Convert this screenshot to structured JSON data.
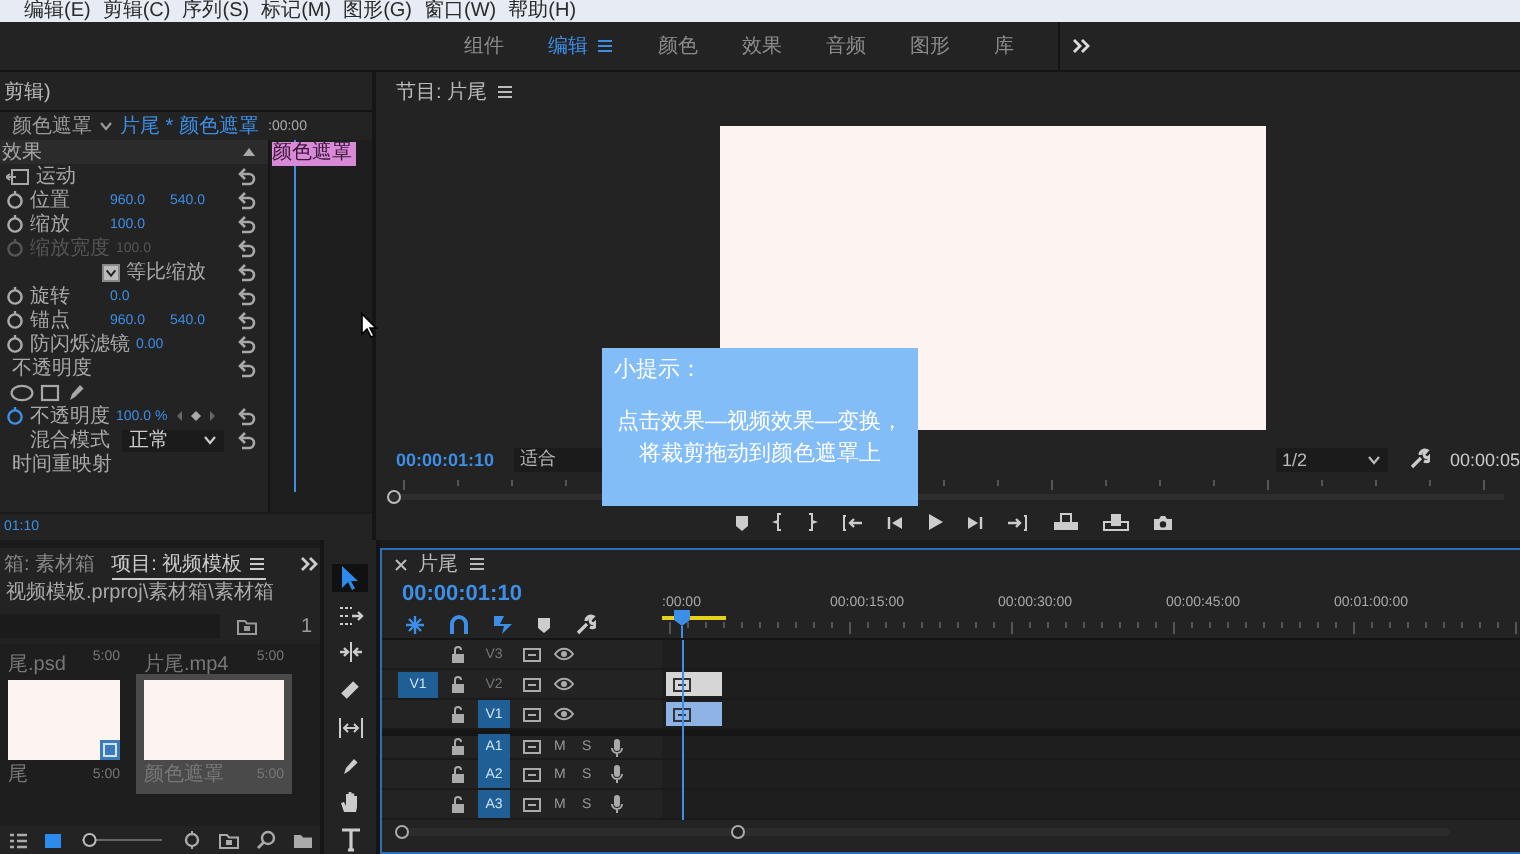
{
  "menu": [
    "编辑(E)",
    "剪辑(C)",
    "序列(S)",
    "标记(M)",
    "图形(G)",
    "窗口(W)",
    "帮助(H)"
  ],
  "workspace": {
    "tabs": [
      {
        "label": "组件",
        "selected": false
      },
      {
        "label": "编辑",
        "selected": true
      },
      {
        "label": "颜色",
        "selected": false
      },
      {
        "label": "效果",
        "selected": false
      },
      {
        "label": "音频",
        "selected": false
      },
      {
        "label": "图形",
        "selected": false
      },
      {
        "label": "库",
        "selected": false
      }
    ]
  },
  "effects": {
    "header": "剪辑)",
    "source": "颜色遮罩",
    "sequence_clip": "片尾 * 颜色遮罩",
    "time": ":00:00",
    "clip_label": "颜色遮罩",
    "timecode": "01:10",
    "rows": [
      {
        "kind": "section",
        "label": "效果"
      },
      {
        "kind": "motion",
        "label": "运动"
      },
      {
        "kind": "prop",
        "label": "位置",
        "values": [
          "960.0",
          "540.0"
        ],
        "disabled": false,
        "animated": false
      },
      {
        "kind": "prop",
        "label": "缩放",
        "values": [
          "100.0"
        ],
        "disabled": false,
        "animated": false
      },
      {
        "kind": "prop",
        "label": "缩放宽度",
        "values": [
          "100.0"
        ],
        "disabled": true,
        "animated": false
      },
      {
        "kind": "checkbox",
        "label": "等比缩放",
        "checked": true
      },
      {
        "kind": "prop",
        "label": "旋转",
        "values": [
          "0.0"
        ],
        "disabled": false,
        "animated": false
      },
      {
        "kind": "prop",
        "label": "锚点",
        "values": [
          "960.0",
          "540.0"
        ],
        "disabled": false,
        "animated": false
      },
      {
        "kind": "prop",
        "label": "防闪烁滤镜",
        "values": [
          "0.00"
        ],
        "disabled": false,
        "animated": false
      },
      {
        "kind": "group",
        "label": "不透明度"
      },
      {
        "kind": "masks"
      },
      {
        "kind": "prop",
        "label": "不透明度",
        "values": [
          "100.0 %"
        ],
        "disabled": false,
        "animated": true
      },
      {
        "kind": "dropdown",
        "label": "混合模式",
        "value": "正常"
      },
      {
        "kind": "label",
        "label": "时间重映射"
      }
    ]
  },
  "program": {
    "title": "节目: 片尾",
    "timecode": "00:00:01:10",
    "zoom": "适合",
    "resolution": "1/2",
    "duration": "00:00:05"
  },
  "tip": {
    "title": "小提示：",
    "lines": [
      "点击效果—视频效果—变换，",
      "将裁剪拖动到颜色遮罩上"
    ]
  },
  "project": {
    "tabs": [
      {
        "label": "箱: 素材箱",
        "selected": false
      },
      {
        "label": "项目: 视频模板",
        "selected": true
      }
    ],
    "path": "视频模板.prproj\\素材箱\\素材箱",
    "count": "1",
    "zoom_slider": {
      "level": 0.05
    },
    "items": [
      {
        "name": "尾.psd",
        "duration": "5:00",
        "caption": "尾",
        "caption_duration": "5:00",
        "selected": false
      },
      {
        "name": "片尾.mp4",
        "duration": "5:00",
        "caption": "颜色遮罩",
        "caption_duration": "5:00",
        "selected": true
      }
    ]
  },
  "tools": [
    {
      "kind": "select",
      "selected": true
    },
    {
      "kind": "track",
      "selected": false
    },
    {
      "kind": "ripple",
      "selected": false
    },
    {
      "kind": "razor",
      "selected": false
    },
    {
      "kind": "slip",
      "selected": false
    },
    {
      "kind": "pen",
      "selected": false
    },
    {
      "kind": "hand",
      "selected": false
    },
    {
      "kind": "type",
      "selected": false
    }
  ],
  "timeline": {
    "title": "片尾",
    "timecode": "00:00:01:10",
    "ruler": [
      ":00:00",
      "00:00:15:00",
      "00:00:30:00",
      "00:00:45:00",
      "00:01:00:00"
    ],
    "tracks": [
      {
        "name": "V3",
        "kind": "video",
        "targeted": false
      },
      {
        "name": "V2",
        "kind": "video",
        "targeted": false,
        "source": "V1",
        "clip": {
          "color": "#d6d6d6"
        }
      },
      {
        "name": "V1",
        "kind": "video",
        "targeted": true,
        "clip": {
          "color": "#8db4e4"
        }
      },
      {
        "name": "A1",
        "kind": "audio",
        "targeted": true,
        "mute": "M",
        "solo": "S"
      },
      {
        "name": "A2",
        "kind": "audio",
        "targeted": true,
        "mute": "M",
        "solo": "S"
      },
      {
        "name": "A3",
        "kind": "audio",
        "targeted": true,
        "mute": "M",
        "solo": "S"
      }
    ]
  }
}
